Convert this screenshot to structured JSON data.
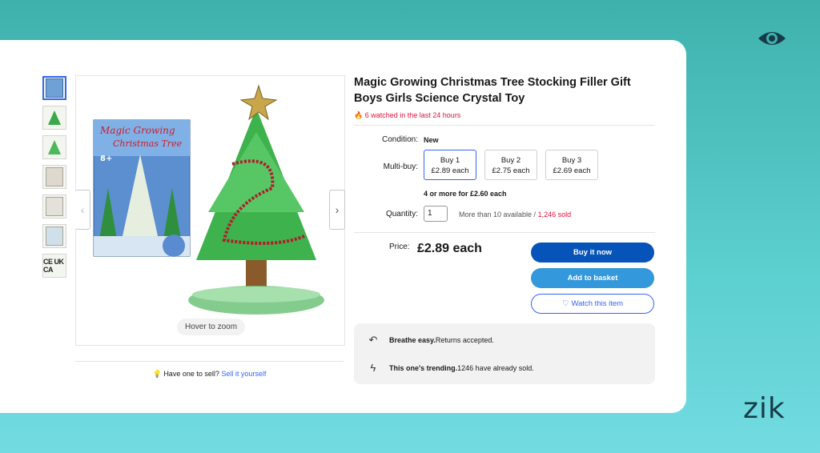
{
  "brand": {
    "name": "zik",
    "icon": "eye-icon"
  },
  "gallery": {
    "thumbnails": [
      "product-box",
      "tree",
      "tree-small",
      "instructions",
      "instructions-2",
      "label",
      "ce-ukca"
    ],
    "ce_text": "CE UK CA",
    "hover_zoom": "Hover to zoom",
    "box_title": "Magic Growing Christmas Tree",
    "age_badge": "8+"
  },
  "listing": {
    "title": "Magic Growing Christmas Tree Stocking Filler Gift Boys Girls Science Crystal Toy",
    "watch_signal": "6 watched in the last 24 hours",
    "condition_label": "Condition:",
    "condition_value": "New",
    "multibuy_label": "Multi-buy:",
    "multibuy_options": [
      {
        "line1": "Buy 1",
        "line2": "£2.89 each",
        "selected": true
      },
      {
        "line1": "Buy 2",
        "line2": "£2.75 each",
        "selected": false
      },
      {
        "line1": "Buy 3",
        "line2": "£2.69 each",
        "selected": false
      }
    ],
    "four_or_more": "4 or more for £2.60 each",
    "quantity_label": "Quantity:",
    "quantity_value": "1",
    "available_text": "More than 10 available /",
    "sold_text": "1,246 sold",
    "price_label": "Price:",
    "price_value": "£2.89 each",
    "buttons": {
      "buy_now": "Buy it now",
      "add_basket": "Add to basket",
      "watch": "Watch this item"
    },
    "info": [
      {
        "icon": "returns-icon",
        "bold": "Breathe easy.",
        "text": " Returns accepted."
      },
      {
        "icon": "lightning-icon",
        "bold": "This one's trending.",
        "text": " 1246 have already sold."
      }
    ]
  },
  "sell": {
    "prompt": "Have one to sell?",
    "link": "Sell it yourself"
  },
  "colors": {
    "primary": "#0654ba",
    "secondary": "#3498dc",
    "link": "#3665f3",
    "alert": "#e0103a"
  }
}
